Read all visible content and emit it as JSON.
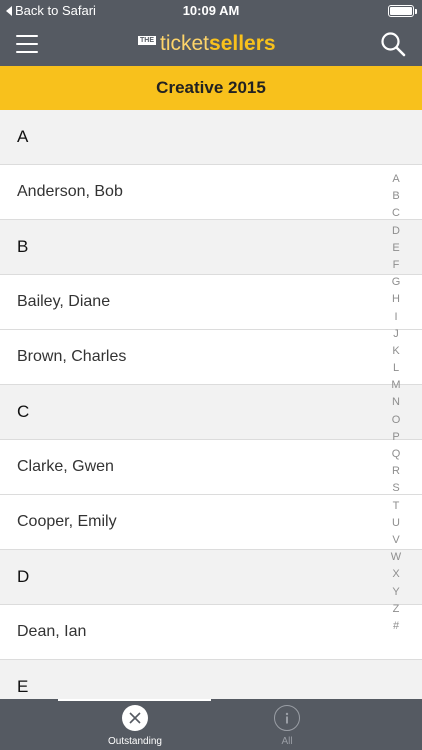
{
  "status_bar": {
    "back_label": "Back to Safari",
    "time": "10:09 AM"
  },
  "navbar": {
    "logo_the": "THE",
    "logo_ticket": "ticket",
    "logo_sellers": "sellers",
    "menu_icon": "hamburger-menu-icon",
    "search_icon": "search-icon"
  },
  "banner": {
    "title": "Creative 2015"
  },
  "list": {
    "rows": [
      {
        "type": "header",
        "text": "A"
      },
      {
        "type": "item",
        "text": "Anderson, Bob"
      },
      {
        "type": "header",
        "text": "B"
      },
      {
        "type": "item",
        "text": "Bailey, Diane"
      },
      {
        "type": "item",
        "text": "Brown, Charles"
      },
      {
        "type": "header",
        "text": "C"
      },
      {
        "type": "item",
        "text": "Clarke, Gwen"
      },
      {
        "type": "item",
        "text": "Cooper, Emily"
      },
      {
        "type": "header",
        "text": "D"
      },
      {
        "type": "item",
        "text": "Dean, Ian"
      },
      {
        "type": "header",
        "text": "E"
      }
    ]
  },
  "index_letters": [
    "A",
    "B",
    "C",
    "D",
    "E",
    "F",
    "G",
    "H",
    "I",
    "J",
    "K",
    "L",
    "M",
    "N",
    "O",
    "P",
    "Q",
    "R",
    "S",
    "T",
    "U",
    "V",
    "W",
    "X",
    "Y",
    "Z",
    "#"
  ],
  "tabbar": {
    "outstanding_label": "Outstanding",
    "outstanding_icon": "close-circle-icon",
    "all_label": "All",
    "all_icon": "info-circle-icon"
  },
  "colors": {
    "nav_background": "#555a62",
    "accent_yellow": "#f8c11c",
    "section_background": "#f2f2f2"
  }
}
